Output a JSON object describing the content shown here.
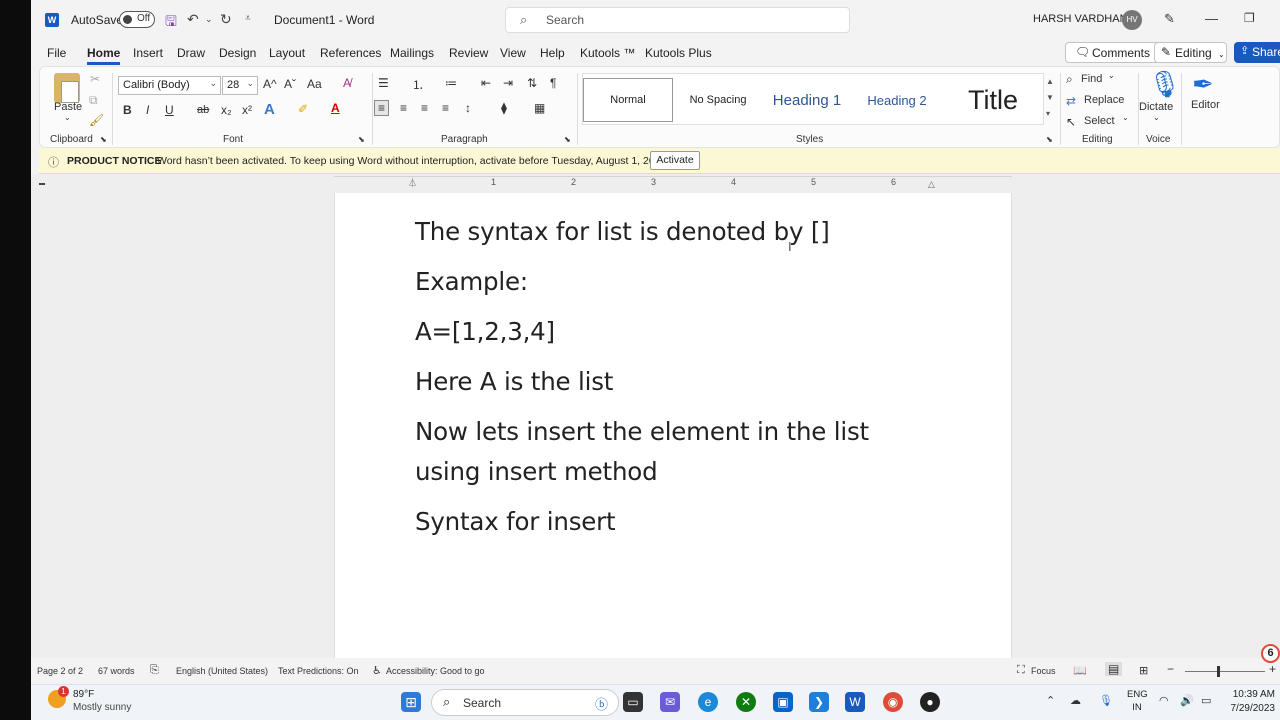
{
  "titlebar": {
    "app_icon": "word-logo",
    "autosave_label": "AutoSave",
    "autosave_state": "Off",
    "document_title": "Document1 - Word",
    "search_placeholder": "Search",
    "user_name": "HARSH VARDHAN",
    "user_initials": "HV"
  },
  "menu": {
    "tabs": [
      "File",
      "Home",
      "Insert",
      "Draw",
      "Design",
      "Layout",
      "References",
      "Mailings",
      "Review",
      "View",
      "Help",
      "Kutools ™",
      "Kutools Plus"
    ],
    "active_tab": "Home",
    "comments_label": "Comments",
    "editing_label": "Editing",
    "share_label": "Share"
  },
  "ribbon": {
    "clipboard": {
      "paste_label": "Paste",
      "group_label": "Clipboard"
    },
    "font": {
      "font_name": "Calibri (Body)",
      "font_size": "28",
      "bold": "B",
      "italic": "I",
      "underline": "U",
      "strikethrough": "ab",
      "subscript": "x₂",
      "superscript": "x²",
      "grow": "A^",
      "shrink": "Aˇ",
      "change_case": "Aa",
      "group_label": "Font"
    },
    "paragraph": {
      "group_label": "Paragraph"
    },
    "styles": {
      "items": [
        "Normal",
        "No Spacing",
        "Heading 1",
        "Heading 2",
        "Title"
      ],
      "selected": "Normal",
      "group_label": "Styles"
    },
    "editing": {
      "find_label": "Find",
      "replace_label": "Replace",
      "select_label": "Select",
      "group_label": "Editing"
    },
    "voice": {
      "dictate_label": "Dictate",
      "group_label": "Voice"
    },
    "editor": {
      "editor_label": "Editor"
    }
  },
  "notice": {
    "title": "PRODUCT NOTICE",
    "message": "Word hasn’t been activated. To keep using Word without interruption, activate before Tuesday, August 1, 2023.",
    "button_label": "Activate"
  },
  "ruler": {
    "numbers": [
      "1",
      "2",
      "3",
      "4",
      "5",
      "6"
    ]
  },
  "document": {
    "lines": [
      "The syntax for list is denoted by []",
      "Example:",
      "A=[1,2,3,4]",
      "Here A is the list",
      "Now lets insert the element in the list",
      "using insert method",
      "Syntax for insert"
    ]
  },
  "statusbar": {
    "page_info": "Page 2 of 2",
    "word_count": "67 words",
    "language": "English (United States)",
    "text_predictions": "Text Predictions: On",
    "accessibility": "Accessibility: Good to go",
    "focus_label": "Focus",
    "badge_number": "6"
  },
  "taskbar": {
    "temperature": "89°F",
    "condition": "Mostly sunny",
    "weather_badge": "1",
    "search_label": "Search",
    "lang_line1": "ENG",
    "lang_line2": "IN",
    "time": "10:39 AM",
    "date": "7/29/2023"
  },
  "colors": {
    "accent": "#185abd",
    "notice_bg": "#fcf7d5",
    "taskbar_bg": "#f0f4f9"
  }
}
